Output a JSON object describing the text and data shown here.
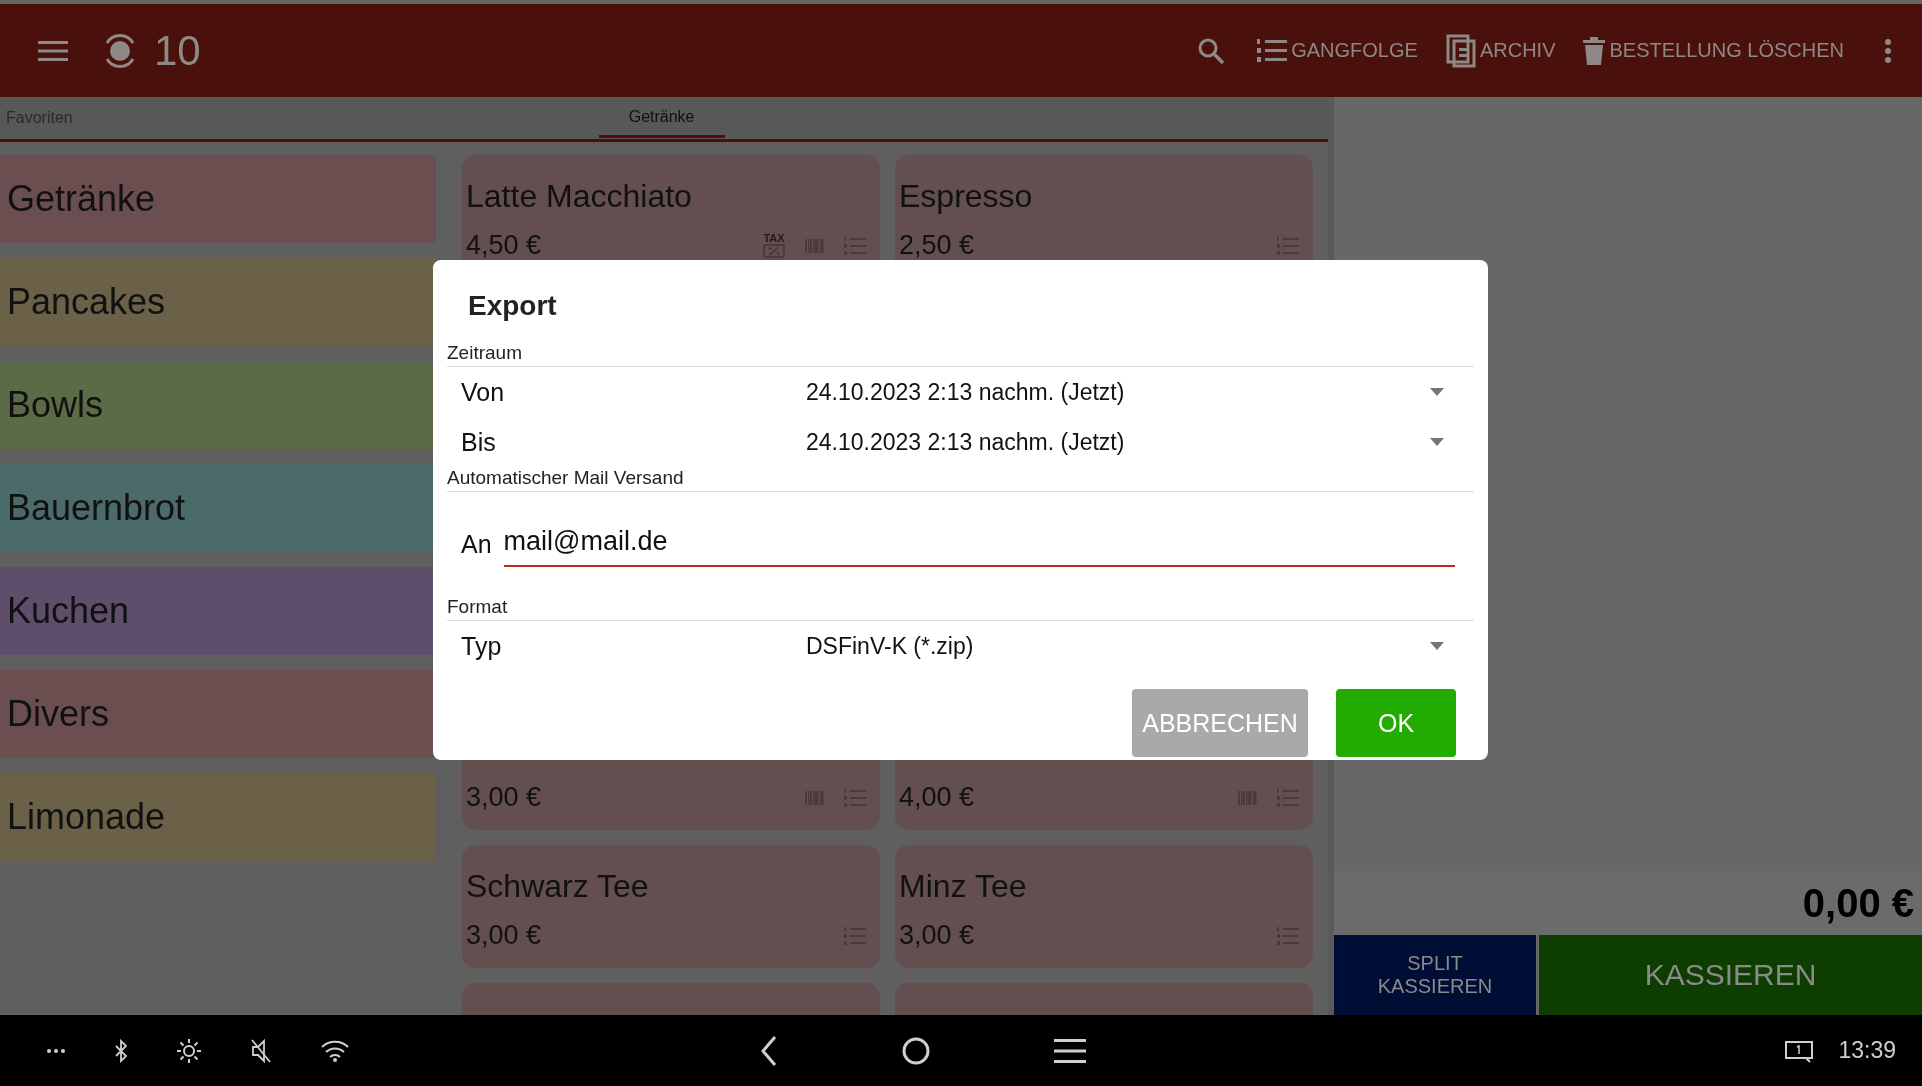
{
  "top_bar": {
    "table_number": "10",
    "actions": [
      {
        "kind": "search"
      },
      {
        "kind": "course",
        "label": "GANGFOLGE"
      },
      {
        "kind": "archive",
        "label": "ARCHIV"
      },
      {
        "kind": "delete",
        "label": "BESTELLUNG LÖSCHEN"
      },
      {
        "kind": "more"
      }
    ]
  },
  "tabs": [
    {
      "label": "Favoriten",
      "selected": false
    },
    {
      "label": "Getränke",
      "selected": true
    }
  ],
  "categories": [
    {
      "label": "Getränke",
      "color": "#6b4f50"
    },
    {
      "label": "Pancakes",
      "color": "#6b6148"
    },
    {
      "label": "Bowls",
      "color": "#5b6b48"
    },
    {
      "label": "Bauernbrot",
      "color": "#4b6b6a"
    },
    {
      "label": "Kuchen",
      "color": "#5e4e6b"
    },
    {
      "label": "Divers",
      "color": "#6b4f50"
    },
    {
      "label": "Limonade",
      "color": "#6b6148"
    }
  ],
  "products": [
    {
      "name": "Latte Macchiato",
      "price": "4,50 €",
      "tax_badge": "TAX",
      "barcode": true
    },
    {
      "name": "Espresso",
      "price": "2,50 €",
      "barcode": false
    },
    {
      "price": "3,00 €",
      "barcode": true
    },
    {
      "price": "4,00 €",
      "barcode": true
    },
    {
      "name": "Schwarz Tee",
      "price": "3,00 €",
      "barcode": false
    },
    {
      "name": "Minz Tee",
      "price": "3,00 €",
      "barcode": false
    }
  ],
  "order": {
    "total": "0,00 €",
    "buttons": [
      {
        "kind": "split",
        "label": "SPLIT KASSIEREN"
      },
      {
        "kind": "pay",
        "label": "KASSIEREN"
      }
    ]
  },
  "dialog": {
    "title": "Export",
    "sections": [
      {
        "heading": "Zeitraum",
        "rows": [
          {
            "kind": "dropdown",
            "label": "Von",
            "value": "24.10.2023 2:13 nachm. (Jetzt)"
          },
          {
            "kind": "dropdown",
            "label": "Bis",
            "value": "24.10.2023 2:13 nachm. (Jetzt)"
          }
        ]
      },
      {
        "heading": "Automatischer Mail Versand",
        "rows": [
          {
            "kind": "input",
            "label": "An",
            "value": "mail@mail.de"
          }
        ]
      },
      {
        "heading": "Format",
        "rows": [
          {
            "kind": "dropdown",
            "label": "Typ",
            "value": "DSFinV-K (*.zip)"
          }
        ]
      }
    ],
    "buttons": [
      {
        "kind": "secondary",
        "label": "ABBRECHEN"
      },
      {
        "kind": "primary",
        "label": "OK"
      }
    ]
  },
  "nav_bar": {
    "clock": "13:39"
  }
}
